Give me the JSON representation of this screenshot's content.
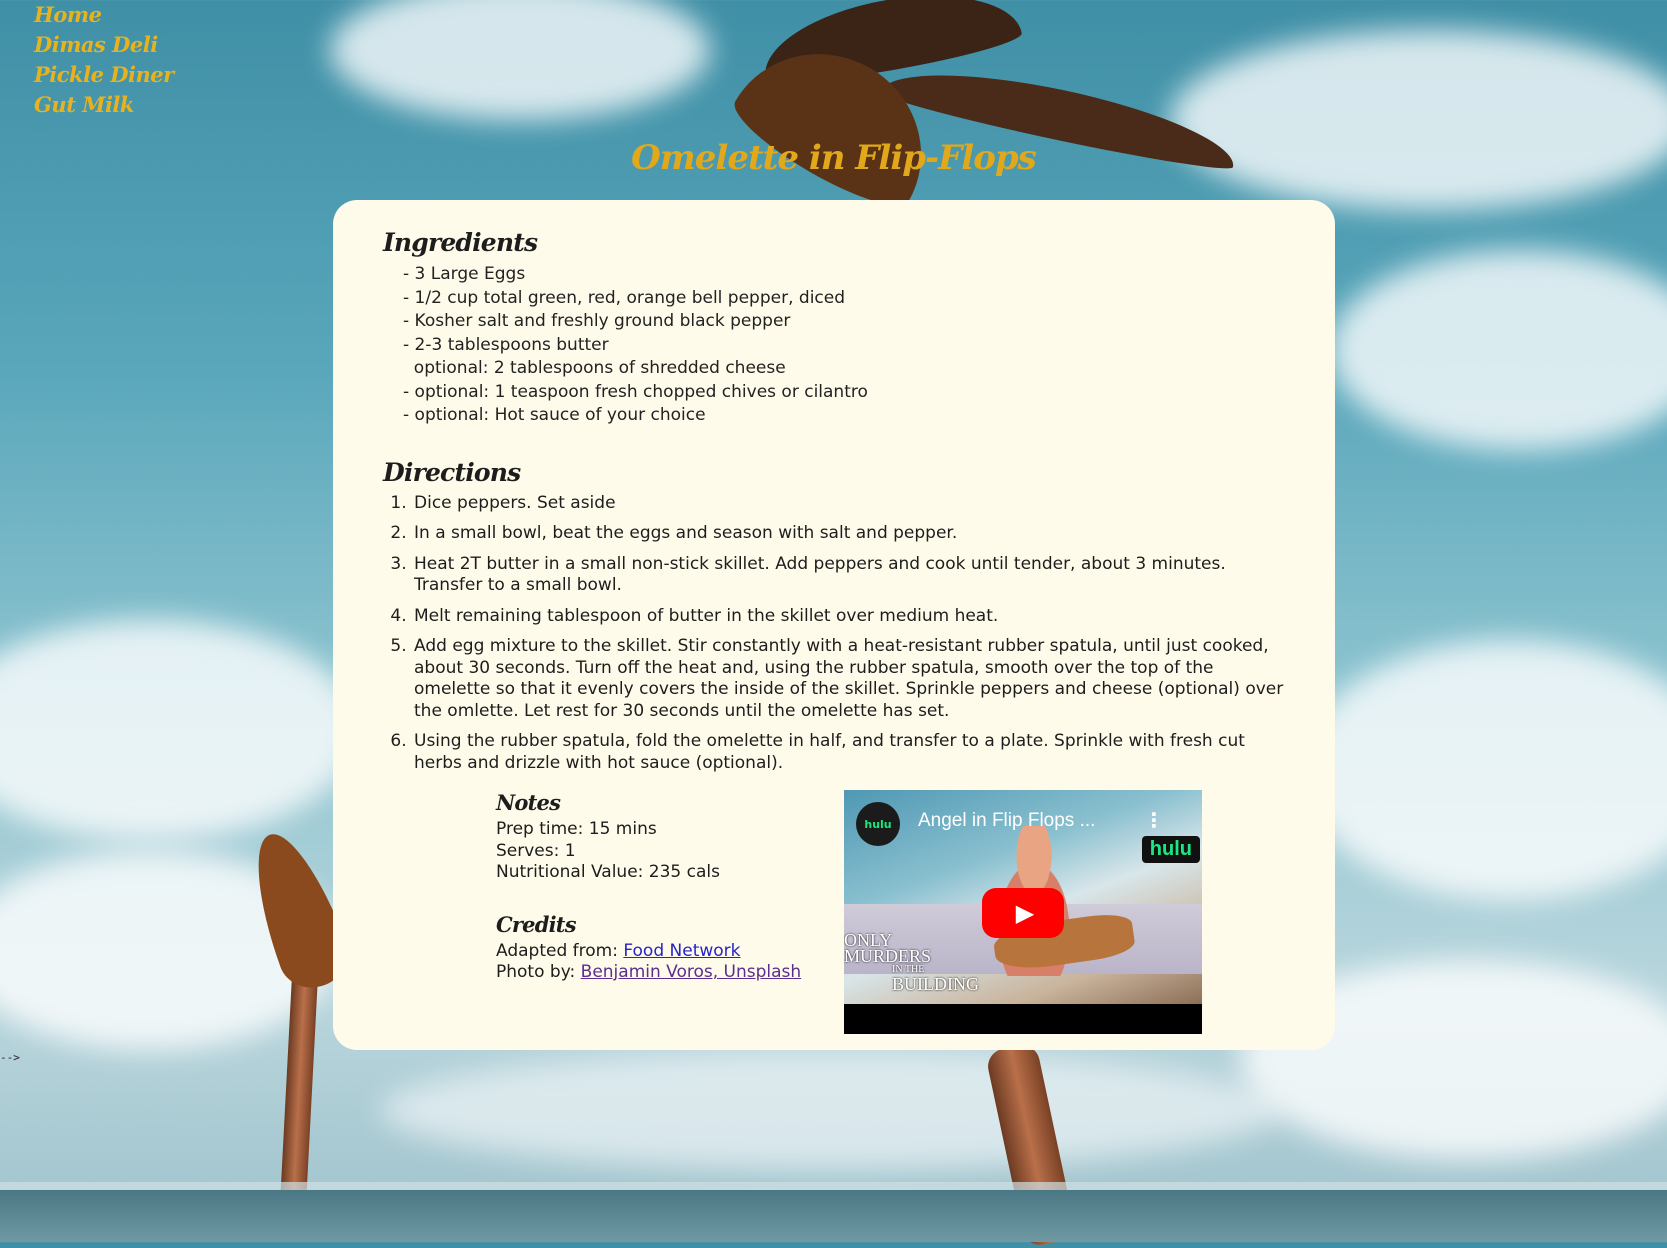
{
  "nav": {
    "items": [
      {
        "label": "Home"
      },
      {
        "label": "Dimas Deli"
      },
      {
        "label": "Pickle Diner"
      },
      {
        "label": "Gut Milk"
      }
    ]
  },
  "page": {
    "title": "Omelette in Flip-Flops",
    "stray_text": "-->"
  },
  "ingredients": {
    "heading": "Ingredients",
    "items": [
      "- 3 Large Eggs",
      "- 1/2 cup total green, red, orange bell pepper, diced",
      "- Kosher salt and freshly ground black pepper",
      "- 2-3 tablespoons butter",
      "  optional: 2 tablespoons of shredded cheese",
      "- optional: 1 teaspoon fresh chopped chives or cilantro",
      "- optional: Hot sauce of your choice"
    ]
  },
  "directions": {
    "heading": "Directions",
    "steps": [
      "Dice peppers. Set aside",
      "In a small bowl, beat the eggs and season with salt and pepper.",
      "Heat 2T butter in a small non-stick skillet. Add peppers and cook until tender, about 3 minutes. Transfer to a small bowl.",
      "Melt remaining tablespoon of butter in the skillet over medium heat.",
      "Add egg mixture to the skillet. Stir constantly with a heat-resistant rubber spatula, until just cooked, about 30 seconds. Turn off the heat and, using the rubber spatula, smooth over the top of the omelette so that it evenly covers the inside of the skillet. Sprinkle peppers and cheese (optional) over the omlette. Let rest for 30 seconds until the omelette has set.",
      "Using the rubber spatula, fold the omelette in half, and transfer to a plate. Sprinkle with fresh cut herbs and drizzle with hot sauce (optional)."
    ]
  },
  "notes": {
    "heading": "Notes",
    "prep_time": "Prep time: 15 mins",
    "serves": "Serves: 1",
    "nutrition": "Nutritional Value: 235 cals"
  },
  "credits": {
    "heading": "Credits",
    "adapted_prefix": "Adapted from: ",
    "adapted_link": "Food Network",
    "photo_prefix": "Photo by: ",
    "photo_link": "Benjamin Voros, Unsplash"
  },
  "video": {
    "channel_badge": "hulu",
    "title": "Angel in Flip Flops ...",
    "brand_badge": "hulu",
    "show_line1": "ONLY",
    "show_line2": "MURDERS",
    "show_line3": "IN THE",
    "show_line4": "BUILDING",
    "play_glyph": "▶",
    "menu_glyph": "⋮"
  },
  "colors": {
    "nav_title": "#e7b21d",
    "card_background": "#fefbea",
    "link": "#2424c9",
    "visited_link": "#5b2d8e",
    "youtube_play": "#ff0000"
  }
}
